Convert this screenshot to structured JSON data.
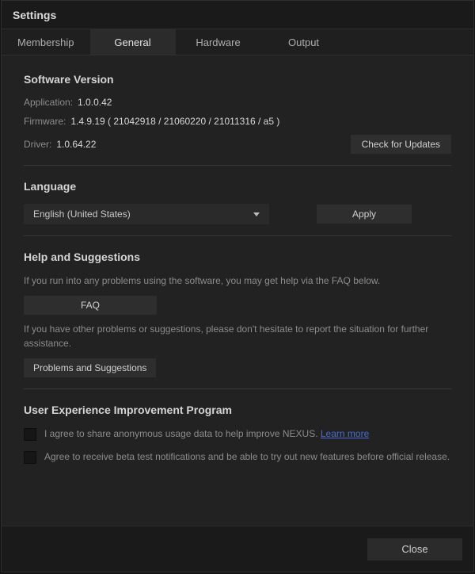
{
  "window_title": "Settings",
  "tabs": {
    "membership": "Membership",
    "general": "General",
    "hardware": "Hardware",
    "output": "Output"
  },
  "software_version": {
    "heading": "Software Version",
    "application_label": "Application:",
    "application_value": "1.0.0.42",
    "firmware_label": "Firmware:",
    "firmware_value": "1.4.9.19 ( 21042918 / 21060220 / 21011316 / a5 )",
    "driver_label": "Driver:",
    "driver_value": "1.0.64.22",
    "check_updates_btn": "Check for Updates"
  },
  "language": {
    "heading": "Language",
    "selected": "English (United States)",
    "apply_btn": "Apply"
  },
  "help": {
    "heading": "Help and Suggestions",
    "line1": "If you run into any problems using the software, you may get help via the FAQ below.",
    "faq_btn": "FAQ",
    "line2": "If you have other problems or suggestions, please don't hesitate to report the situation for further assistance.",
    "problems_btn": "Problems and Suggestions"
  },
  "ux": {
    "heading": "User Experience Improvement Program",
    "opt1_prefix": "I agree to share anonymous usage data to help improve NEXUS. ",
    "opt1_link": "Learn more",
    "opt2": "Agree to receive beta test notifications and be able to try out new features before official release."
  },
  "footer": {
    "close_btn": "Close"
  }
}
